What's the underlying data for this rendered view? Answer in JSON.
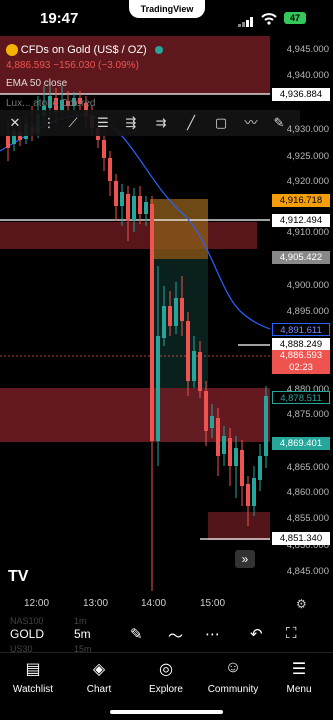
{
  "status": {
    "time": "19:47",
    "app_pill": "TradingView",
    "battery": "47"
  },
  "header": {
    "symbol_title": "CFDs on Gold (US$ / OZ)",
    "price": "4,886.593",
    "change": "−156.030 (−3.09%)",
    "indicator": "EMA 50 close",
    "overlay_text": "Lux... atoric Colored"
  },
  "price_axis": [
    "4,945.000",
    "4,940.000",
    "4,930.000",
    "4,925.000",
    "4,920.000",
    "4,910.000",
    "4,900.000",
    "4,895.000",
    "4,880.000",
    "4,875.000",
    "4,865.000",
    "4,860.000",
    "4,855.000",
    "4,850.000",
    "4,845.000"
  ],
  "price_tags": {
    "t1": "4,936.884",
    "t2": "4,916.718",
    "t3": "4,912.494",
    "t4": "4,905.422",
    "t5": "4,891.611",
    "t6": "4,888.249",
    "t7": "4,886.593",
    "t7b": "02:23",
    "t8": "4,878.511",
    "t9": "4,869.401",
    "t10": "4,851.340"
  },
  "time_axis": [
    "12:00",
    "13:00",
    "14:00",
    "15:00"
  ],
  "symbar": {
    "watch_hint": "NAS100",
    "interval_hint": "1m",
    "symbol": "GOLD",
    "interval": "5m",
    "sub1": "US30",
    "sub2": "15m"
  },
  "nav": [
    {
      "label": "Watchlist"
    },
    {
      "label": "Chart"
    },
    {
      "label": "Explore"
    },
    {
      "label": "Community"
    },
    {
      "label": "Menu"
    }
  ],
  "colors": {
    "up": "#26a69a",
    "down": "#ef5350",
    "zone": "#7a1f24",
    "ema": "#2962ff"
  }
}
